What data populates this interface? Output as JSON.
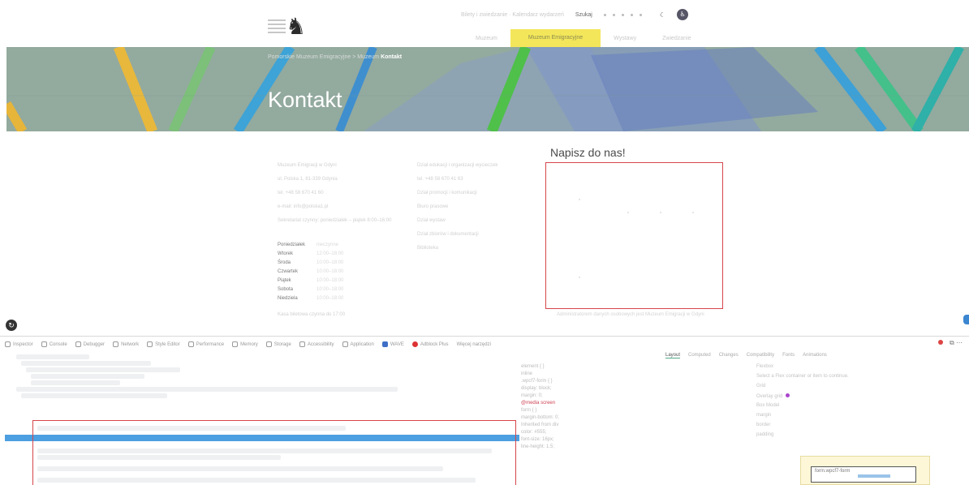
{
  "header": {
    "logo": "museum-logo",
    "topbar": {
      "left_text": "Bilety i zwiedzanie · Kalendarz wydarzeń",
      "search_label": "Szukaj",
      "dots": 5,
      "theme_icon": "moon-icon",
      "badge_icon": "accessibility-icon"
    },
    "nav": {
      "items": [
        "Muzeum",
        "Muzeum Emigracyjne",
        "Wystawy",
        "Zwiedzanie"
      ],
      "active_index": 1
    }
  },
  "hero": {
    "breadcrumb_path": "Pomorskie Muzeum Emigracyjne > Muzeum ",
    "breadcrumb_current": "Kontakt",
    "title": "Kontakt"
  },
  "contact": {
    "col1": [
      "Muzeum Emigracji w Gdyni",
      "ul. Polska 1, 81-339 Gdynia",
      "tel. +48 58 670 41 60",
      "e-mail: info@polska1.pl",
      "Sekretariat czynny: poniedziałek – piątek 8:00–16:00"
    ],
    "hours": [
      {
        "day": "Poniedziałek",
        "time": "nieczynne"
      },
      {
        "day": "Wtorek",
        "time": "12:00–18:00"
      },
      {
        "day": "Środa",
        "time": "10:00–18:00"
      },
      {
        "day": "Czwartek",
        "time": "10:00–18:00"
      },
      {
        "day": "Piątek",
        "time": "10:00–18:00"
      },
      {
        "day": "Sobota",
        "time": "10:00–18:00"
      },
      {
        "day": "Niedziela",
        "time": "10:00–18:00"
      }
    ],
    "col1_footer": "Kasa biletowa czynna do 17:00",
    "col2": [
      "Dział edukacji i organizacji wycieczek",
      "tel. +48 58 670 41 63",
      "Dział promocji i komunikacji",
      "Biuro prasowe",
      "Dział wystaw",
      "Dział zbiorów i dokumentacji",
      "Biblioteka"
    ]
  },
  "form": {
    "title": "Napisz do nas!",
    "note": "Administratorem danych osobowych jest Muzeum Emigracji w Gdyni"
  },
  "devtools": {
    "tabs": [
      {
        "icon": "inspector-icon",
        "label": "Inspector"
      },
      {
        "icon": "console-icon",
        "label": "Console"
      },
      {
        "icon": "debugger-icon",
        "label": "Debugger"
      },
      {
        "icon": "network-icon",
        "label": "Network"
      },
      {
        "icon": "style-editor-icon",
        "label": "Style Editor"
      },
      {
        "icon": "performance-icon",
        "label": "Performance"
      },
      {
        "icon": "memory-icon",
        "label": "Memory"
      },
      {
        "icon": "storage-icon",
        "label": "Storage"
      },
      {
        "icon": "accessibility-icon",
        "label": "Accessibility"
      },
      {
        "icon": "application-icon",
        "label": "Application"
      },
      {
        "icon": "wave-icon",
        "label": "WAVE"
      },
      {
        "icon": "adblock-icon",
        "label": "Adblock Plus"
      },
      {
        "icon": "more-icon",
        "label": "Więcej narzędzi"
      }
    ],
    "toolbar": [
      "Layout",
      "Computed",
      "Changes",
      "Compatibility",
      "Fonts",
      "Animations"
    ],
    "toolbar_selected": 0,
    "rules": [
      "element { }",
      "inline",
      ".wpcf7-form { }",
      "display: block;",
      "margin: 0;",
      "@media screen",
      "form { }",
      "margin-bottom: 0;",
      "Inherited from div",
      "color: #555;",
      "font-size: 16px;",
      "line-height: 1.5;"
    ],
    "computed": [
      "Flexbox",
      "Select a Flex container or item to continue.",
      "Grid",
      "Overlay grid",
      "Box Model",
      "margin",
      "border",
      "padding"
    ],
    "box_label": "form.wpcf7-form"
  }
}
